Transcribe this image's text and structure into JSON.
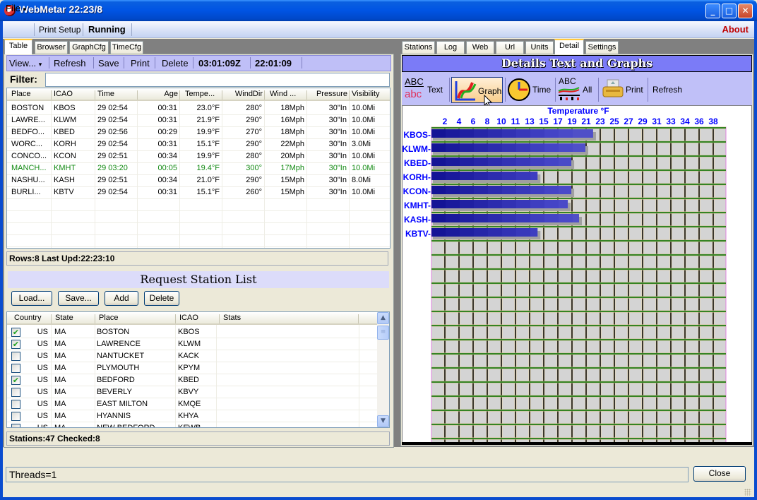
{
  "window": {
    "title": "WebMetar 22:23/8",
    "app_icon": "webmetar-app-icon",
    "controls": {
      "minimize": "_",
      "maximize": "□",
      "close": "✕"
    }
  },
  "menubar": {
    "file": "File",
    "file_arrow": "▾",
    "print_setup": "Print Setup",
    "running": "Running",
    "about": "About"
  },
  "left_tabs": [
    {
      "label": "Table",
      "active": true
    },
    {
      "label": "Browser",
      "active": false
    },
    {
      "label": "GraphCfg",
      "active": false
    },
    {
      "label": "TimeCfg",
      "active": false
    }
  ],
  "left_toolbar": {
    "view": "View...",
    "view_arrow": "▾",
    "refresh": "Refresh",
    "save": "Save",
    "print": "Print",
    "delete": "Delete",
    "utc_time": "03:01:09Z",
    "local_time": "22:01:09"
  },
  "filter": {
    "label": "Filter:",
    "value": ""
  },
  "metar_table": {
    "columns": [
      "Place",
      "ICAO",
      "Time",
      "Age",
      "Tempe...",
      "WindDir",
      "Wind ...",
      "Pressure",
      "Visibility"
    ],
    "rows": [
      {
        "place": "BOSTON",
        "icao": "KBOS",
        "time": "29 02:54",
        "age": "00:31",
        "temp": "23.0°F",
        "winddir": "280°",
        "wind": "18Mph",
        "pressure": "30\"In",
        "visibility": "10.0Mi",
        "highlight": false
      },
      {
        "place": "LAWRE...",
        "icao": "KLWM",
        "time": "29 02:54",
        "age": "00:31",
        "temp": "21.9°F",
        "winddir": "290°",
        "wind": "16Mph",
        "pressure": "30\"In",
        "visibility": "10.0Mi",
        "highlight": false
      },
      {
        "place": "BEDFO...",
        "icao": "KBED",
        "time": "29 02:56",
        "age": "00:29",
        "temp": "19.9°F",
        "winddir": "270°",
        "wind": "18Mph",
        "pressure": "30\"In",
        "visibility": "10.0Mi",
        "highlight": false
      },
      {
        "place": "WORC...",
        "icao": "KORH",
        "time": "29 02:54",
        "age": "00:31",
        "temp": "15.1°F",
        "winddir": "290°",
        "wind": "22Mph",
        "pressure": "30\"In",
        "visibility": "3.0Mi",
        "highlight": false
      },
      {
        "place": "CONCO...",
        "icao": "KCON",
        "time": "29 02:51",
        "age": "00:34",
        "temp": "19.9°F",
        "winddir": "280°",
        "wind": "20Mph",
        "pressure": "30\"In",
        "visibility": "10.0Mi",
        "highlight": false
      },
      {
        "place": "MANCH...",
        "icao": "KMHT",
        "time": "29 03:20",
        "age": "00:05",
        "temp": "19.4°F",
        "winddir": "300°",
        "wind": "17Mph",
        "pressure": "30\"In",
        "visibility": "10.0Mi",
        "highlight": true
      },
      {
        "place": "NASHU...",
        "icao": "KASH",
        "time": "29 02:51",
        "age": "00:34",
        "temp": "21.0°F",
        "winddir": "290°",
        "wind": "15Mph",
        "pressure": "30\"In",
        "visibility": "8.0Mi",
        "highlight": false
      },
      {
        "place": "BURLI...",
        "icao": "KBTV",
        "time": "29 02:54",
        "age": "00:31",
        "temp": "15.1°F",
        "winddir": "260°",
        "wind": "15Mph",
        "pressure": "30\"In",
        "visibility": "10.0Mi",
        "highlight": false
      }
    ],
    "highlight_color": "#138a13"
  },
  "table_status": "Rows:8  Last Upd:22:23:10",
  "request_station_list": {
    "title": "Request Station List",
    "buttons": {
      "load": "Load...",
      "save": "Save...",
      "add": "Add",
      "delete": "Delete"
    },
    "columns": [
      "Country",
      "State",
      "Place",
      "ICAO",
      "Stats"
    ],
    "rows": [
      {
        "checked": true,
        "country": "US",
        "state": "MA",
        "place": "BOSTON",
        "icao": "KBOS",
        "stats": ""
      },
      {
        "checked": true,
        "country": "US",
        "state": "MA",
        "place": "LAWRENCE",
        "icao": "KLWM",
        "stats": ""
      },
      {
        "checked": false,
        "country": "US",
        "state": "MA",
        "place": "NANTUCKET",
        "icao": "KACK",
        "stats": ""
      },
      {
        "checked": false,
        "country": "US",
        "state": "MA",
        "place": "PLYMOUTH",
        "icao": "KPYM",
        "stats": ""
      },
      {
        "checked": true,
        "country": "US",
        "state": "MA",
        "place": "BEDFORD",
        "icao": "KBED",
        "stats": ""
      },
      {
        "checked": false,
        "country": "US",
        "state": "MA",
        "place": "BEVERLY",
        "icao": "KBVY",
        "stats": ""
      },
      {
        "checked": false,
        "country": "US",
        "state": "MA",
        "place": "EAST MILTON",
        "icao": "KMQE",
        "stats": ""
      },
      {
        "checked": false,
        "country": "US",
        "state": "MA",
        "place": "HYANNIS",
        "icao": "KHYA",
        "stats": ""
      },
      {
        "checked": false,
        "country": "US",
        "state": "MA",
        "place": "NEW BEDFORD",
        "icao": "KEWB",
        "stats": ""
      }
    ],
    "status": "Stations:47   Checked:8"
  },
  "right_tabs": [
    {
      "label": "Stations",
      "active": false
    },
    {
      "label": "Log",
      "active": false
    },
    {
      "label": "Web",
      "active": false
    },
    {
      "label": "Url",
      "active": false
    },
    {
      "label": "Units",
      "active": false
    },
    {
      "label": "Detail",
      "active": true
    },
    {
      "label": "Settings",
      "active": false
    }
  ],
  "details": {
    "title": "Details Text and Graphs",
    "toolbar": {
      "text": "Text",
      "graph": "Graph",
      "time": "Time",
      "all": "All",
      "print": "Print",
      "refresh": "Refresh",
      "icon_text_abc_upper": "ABC",
      "icon_text_abc_lower": "abc",
      "icon_all_abc": "ABC"
    }
  },
  "chart_data": {
    "type": "bar",
    "orientation": "horizontal",
    "title": "Temperature °F",
    "xlabel": "Temperature °F",
    "ylabel": "",
    "x_tick_labels": [
      "2",
      "4",
      "6",
      "8",
      "10",
      "11",
      "13",
      "15",
      "17",
      "19",
      "21",
      "23",
      "25",
      "27",
      "29",
      "31",
      "33",
      "34",
      "36",
      "38"
    ],
    "xlim": [
      0,
      40
    ],
    "categories": [
      "KBOS",
      "KLWM",
      "KBED",
      "KORH",
      "KCON",
      "KMHT",
      "KASH",
      "KBTV"
    ],
    "category_labels": [
      "KBOS-",
      "KLWM-",
      "KBED-",
      "KORH-",
      "KCON-",
      "KMHT-",
      "KASH-",
      "KBTV-"
    ],
    "values": [
      23.0,
      21.9,
      19.9,
      15.1,
      19.9,
      19.4,
      21.0,
      15.1
    ],
    "empty_rows": 14,
    "grid": true,
    "colors": {
      "bar": "#1a1a9a",
      "shadow": "#a0a0a0",
      "plot_bg": "#d4d4d4",
      "hgrid": "#007000",
      "vgrid": "#000000",
      "border": "#e080e0",
      "label": "#0000ff"
    }
  },
  "footer": {
    "threads": "Threads=1",
    "close": "Close"
  }
}
